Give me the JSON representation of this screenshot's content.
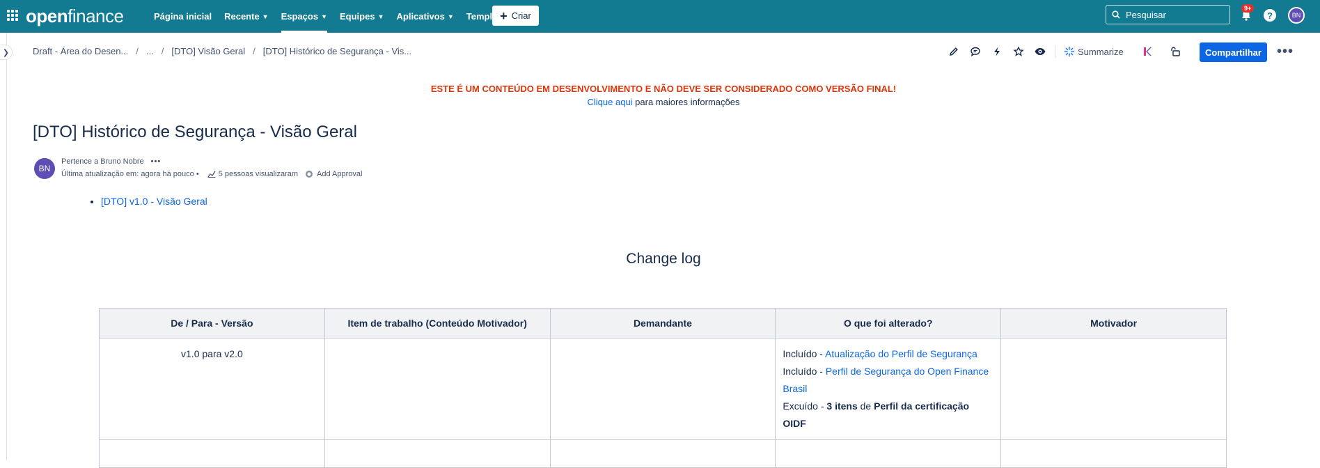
{
  "topnav": {
    "logo_bold": "open",
    "logo_light": "finance",
    "items": [
      {
        "label": "Página inicial",
        "has_chevron": false,
        "active": false
      },
      {
        "label": "Recente",
        "has_chevron": true,
        "active": false
      },
      {
        "label": "Espaços",
        "has_chevron": true,
        "active": true
      },
      {
        "label": "Equipes",
        "has_chevron": true,
        "active": false
      },
      {
        "label": "Aplicativos",
        "has_chevron": true,
        "active": false
      },
      {
        "label": "Templates",
        "has_chevron": false,
        "active": false
      }
    ],
    "create_label": "Criar",
    "search_placeholder": "Pesquisar",
    "notifications_badge": "9+",
    "help_label": "?",
    "avatar_initials": "BN"
  },
  "breadcrumb": {
    "items": [
      "Draft - Área do Desen...",
      "...",
      "[DTO] Visão Geral",
      "[DTO] Histórico de Segurança - Vis..."
    ],
    "separator": "/"
  },
  "toolbar": {
    "icons": [
      "pencil-icon",
      "comment-icon",
      "lightning-icon",
      "star-icon",
      "eye-icon"
    ],
    "summarize_label": "Summarize",
    "share_label": "Compartilhar",
    "more_label": "•••"
  },
  "warning": {
    "headline": "ESTE É UM CONTEÚDO EM DESENVOLVIMENTO E NÃO DEVE SER CONSIDERADO COMO VERSÃO FINAL!",
    "link_text": "Clique aqui",
    "rest_text": " para maiores informações"
  },
  "page": {
    "title": "[DTO] Histórico de Segurança - Visão Geral",
    "owner_text": "Pertence a Bruno Nobre",
    "owner_more": "•••",
    "avatar_initials": "BN",
    "last_updated": "Última atualização em: agora há pouco •",
    "views": "5 pessoas visualizaram",
    "approval": "Add Approval"
  },
  "children": [
    {
      "label": "[DTO] v1.0 - Visão Geral"
    }
  ],
  "changelog": {
    "heading": "Change log",
    "columns": [
      "De / Para - Versão",
      "Item de trabalho (Conteúdo Motivador)",
      "Demandante",
      "O que foi alterado?",
      "Motivador"
    ],
    "row1": {
      "version": "v1.0 para v2.0",
      "work_item": "",
      "requester": "",
      "changes": [
        {
          "prefix": "Incluído - ",
          "link": "Atualização do Perfil de Segurança"
        },
        {
          "prefix": "Incluído - ",
          "link": "Perfil de Segurança do Open Finance Brasil"
        }
      ],
      "excluded_prefix": "Excuído - ",
      "excluded_bold1": "3 itens",
      "excluded_mid": " de ",
      "excluded_bold2": "Perfil da certificação OIDF",
      "motivator": ""
    }
  }
}
